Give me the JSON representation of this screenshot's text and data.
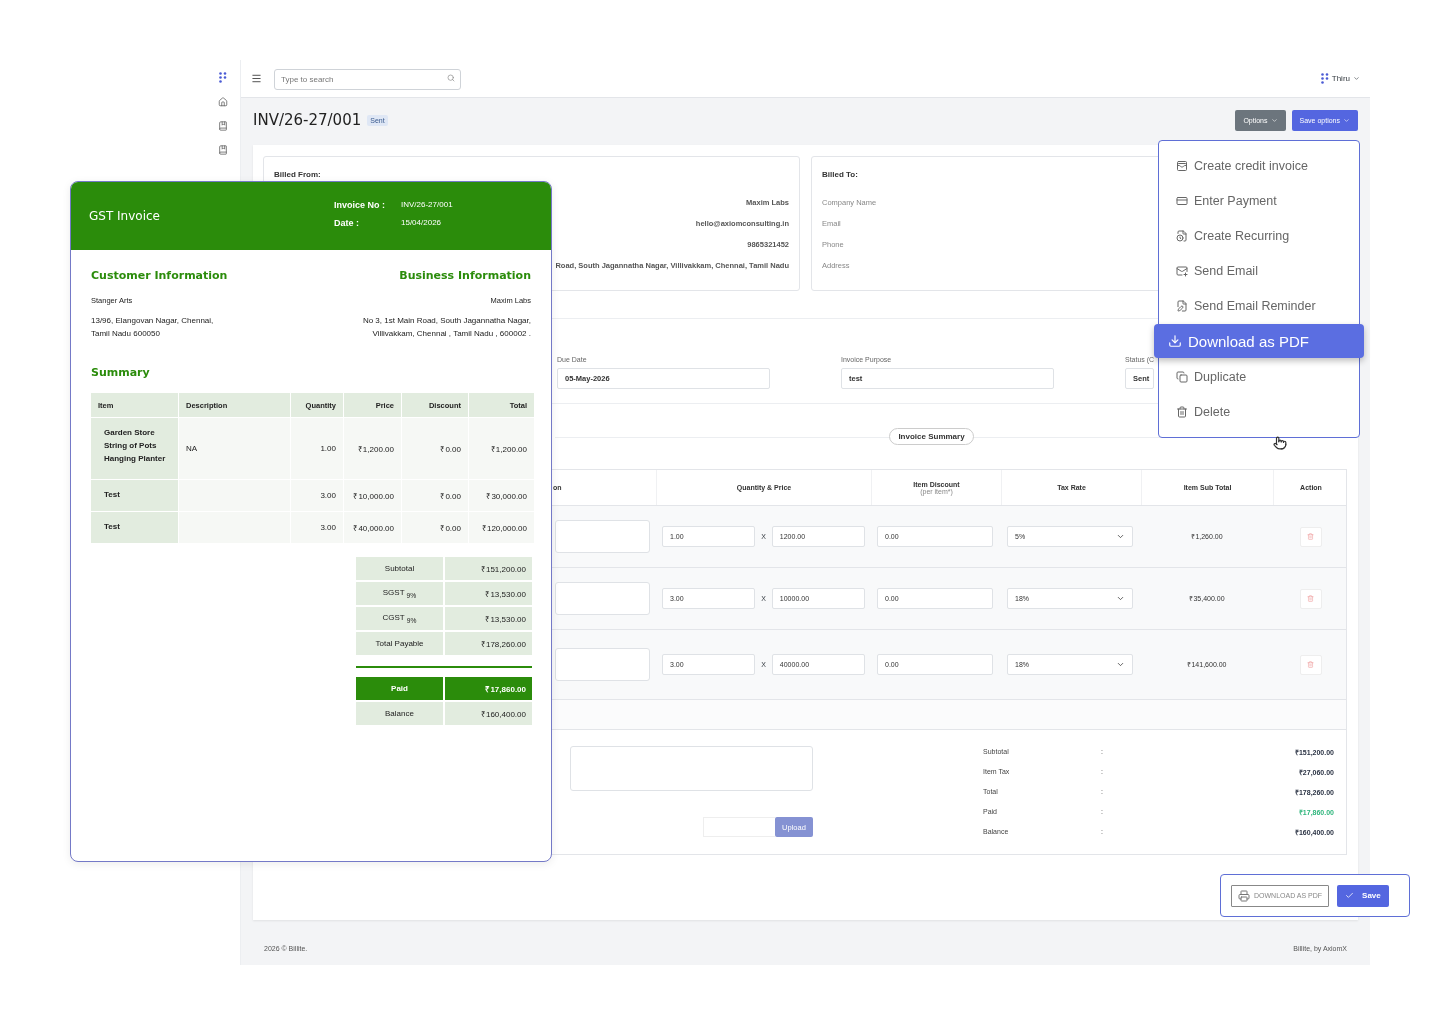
{
  "topbar": {
    "search": {
      "placeholder": "Type to search"
    },
    "user": "Thiru"
  },
  "header": {
    "title": "INV/26-27/001",
    "status": "Sent",
    "buttons": [
      "Options",
      "Save options"
    ]
  },
  "billed_from": {
    "label": "Billed From:",
    "lines": [
      "Maxim Labs",
      "hello@axiomconsulting.in",
      "9865321452",
      "Road, South Jagannatha Nagar, Villivakkam, Chennai, Tamil Nadu"
    ]
  },
  "billed_to": {
    "label": "Billed To:",
    "lines": [
      "Company Name",
      "Email",
      "Phone",
      "Address"
    ]
  },
  "details": [
    {
      "label": "Due Date",
      "value": "05-May-2026"
    },
    {
      "label": "Invoice Purpose",
      "value": "test"
    },
    {
      "label": "Status (C",
      "value": "Sent"
    }
  ],
  "items_table": {
    "title": "Invoice Summary",
    "columns": [
      {
        "label": "on"
      },
      {
        "label": "Quantity & Price"
      },
      {
        "label": "Item Discount",
        "note": "(per item*)"
      },
      {
        "label": "Tax Rate"
      },
      {
        "label": "Item Sub Total"
      },
      {
        "label": "Action"
      }
    ],
    "rows": [
      {
        "quantity": "1.00",
        "times": "X",
        "price": "1200.00",
        "discount": "0.00",
        "tax": "5%",
        "subtotal": "₹1,260.00"
      },
      {
        "quantity": "3.00",
        "times": "X",
        "price": "10000.00",
        "discount": "0.00",
        "tax": "18%",
        "subtotal": "₹35,400.00"
      },
      {
        "quantity": "3.00",
        "times": "X",
        "price": "40000.00",
        "discount": "0.00",
        "tax": "18%",
        "subtotal": "₹141,600.00"
      }
    ]
  },
  "upload_button": "Upload",
  "totals": [
    {
      "label": "Subtotal",
      "sep": ":",
      "value": "₹151,200.00",
      "kind": "plain"
    },
    {
      "label": "Item Tax",
      "sep": ":",
      "value": "₹27,060.00",
      "kind": "plain"
    },
    {
      "label": "Total",
      "sep": ":",
      "value": "₹178,260.00",
      "kind": "plain"
    },
    {
      "label": "Paid",
      "sep": ":",
      "value": "₹17,860.00",
      "kind": "paid"
    },
    {
      "label": "Balance",
      "sep": ":",
      "value": "₹160,400.00",
      "kind": "plain"
    }
  ],
  "actions": {
    "download": "DOWNLOAD AS PDF",
    "save": "Save"
  },
  "footer": {
    "left": "2026 © Billite.",
    "right": "Billite, by AxiomX"
  },
  "options_menu": {
    "items": [
      {
        "label": "Create credit invoice",
        "kind": "credit",
        "selected": false
      },
      {
        "label": "Enter Payment",
        "kind": "payment",
        "selected": false
      },
      {
        "label": "Create Recurring",
        "kind": "recurring",
        "selected": false
      },
      {
        "label": "Send Email",
        "kind": "email",
        "selected": false
      },
      {
        "label": "Send Email Reminder",
        "kind": "reminder",
        "selected": false
      },
      {
        "label": "Download as PDF",
        "kind": "download",
        "selected": true
      },
      {
        "label": "Duplicate",
        "kind": "duplicate",
        "selected": false
      },
      {
        "label": "Delete",
        "kind": "delete",
        "selected": false
      }
    ]
  },
  "invoice_preview": {
    "title": "GST Invoice",
    "meta": [
      {
        "label": "Invoice No :",
        "value": "INV/26-27/001"
      },
      {
        "label": "Date :",
        "value": "15/04/2026"
      }
    ],
    "customer": {
      "heading": "Customer Information",
      "name": "Stanger Arts",
      "address": [
        "13/96, Elangovan Nagar, Chennai,",
        "Tamil Nadu 600050"
      ]
    },
    "business": {
      "heading": "Business Information",
      "name": "Maxim Labs",
      "address": [
        "No 3, 1st Main Road, South Jagannatha Nagar,",
        "Villivakkam, Chennai , Tamil Nadu , 600002 ."
      ]
    },
    "summary_heading": "Summary",
    "columns": [
      "Item",
      "Description",
      "Quantity",
      "Price",
      "Discount",
      "Total"
    ],
    "rows": [
      {
        "item": [
          "Garden Store",
          "String of Pots",
          "Hanging Planter"
        ],
        "description": "NA",
        "quantity": "1.00",
        "price": "₹1,200.00",
        "discount": "₹0.00",
        "total": "₹1,200.00"
      },
      {
        "item": [
          "Test"
        ],
        "quantity": "3.00",
        "price": "₹10,000.00",
        "discount": "₹0.00",
        "total": "₹30,000.00"
      },
      {
        "item": [
          "Test"
        ],
        "quantity": "3.00",
        "price": "₹40,000.00",
        "discount": "₹0.00",
        "total": "₹120,000.00"
      }
    ],
    "totals": [
      {
        "label": "Subtotal",
        "value": "₹151,200.00"
      },
      {
        "label": "SGST $_{9%}$",
        "value": "₹13,530.00"
      },
      {
        "label": "CGST $_{9%}$",
        "value": "₹13,530.00"
      },
      {
        "label": "Total Payable",
        "value": "₹178,260.00"
      }
    ],
    "settlement": [
      {
        "label": "Paid",
        "value": "₹17,860.00",
        "kind": "highlight"
      },
      {
        "label": "Balance",
        "value": "₹160,400.00",
        "kind": "plain"
      }
    ]
  }
}
